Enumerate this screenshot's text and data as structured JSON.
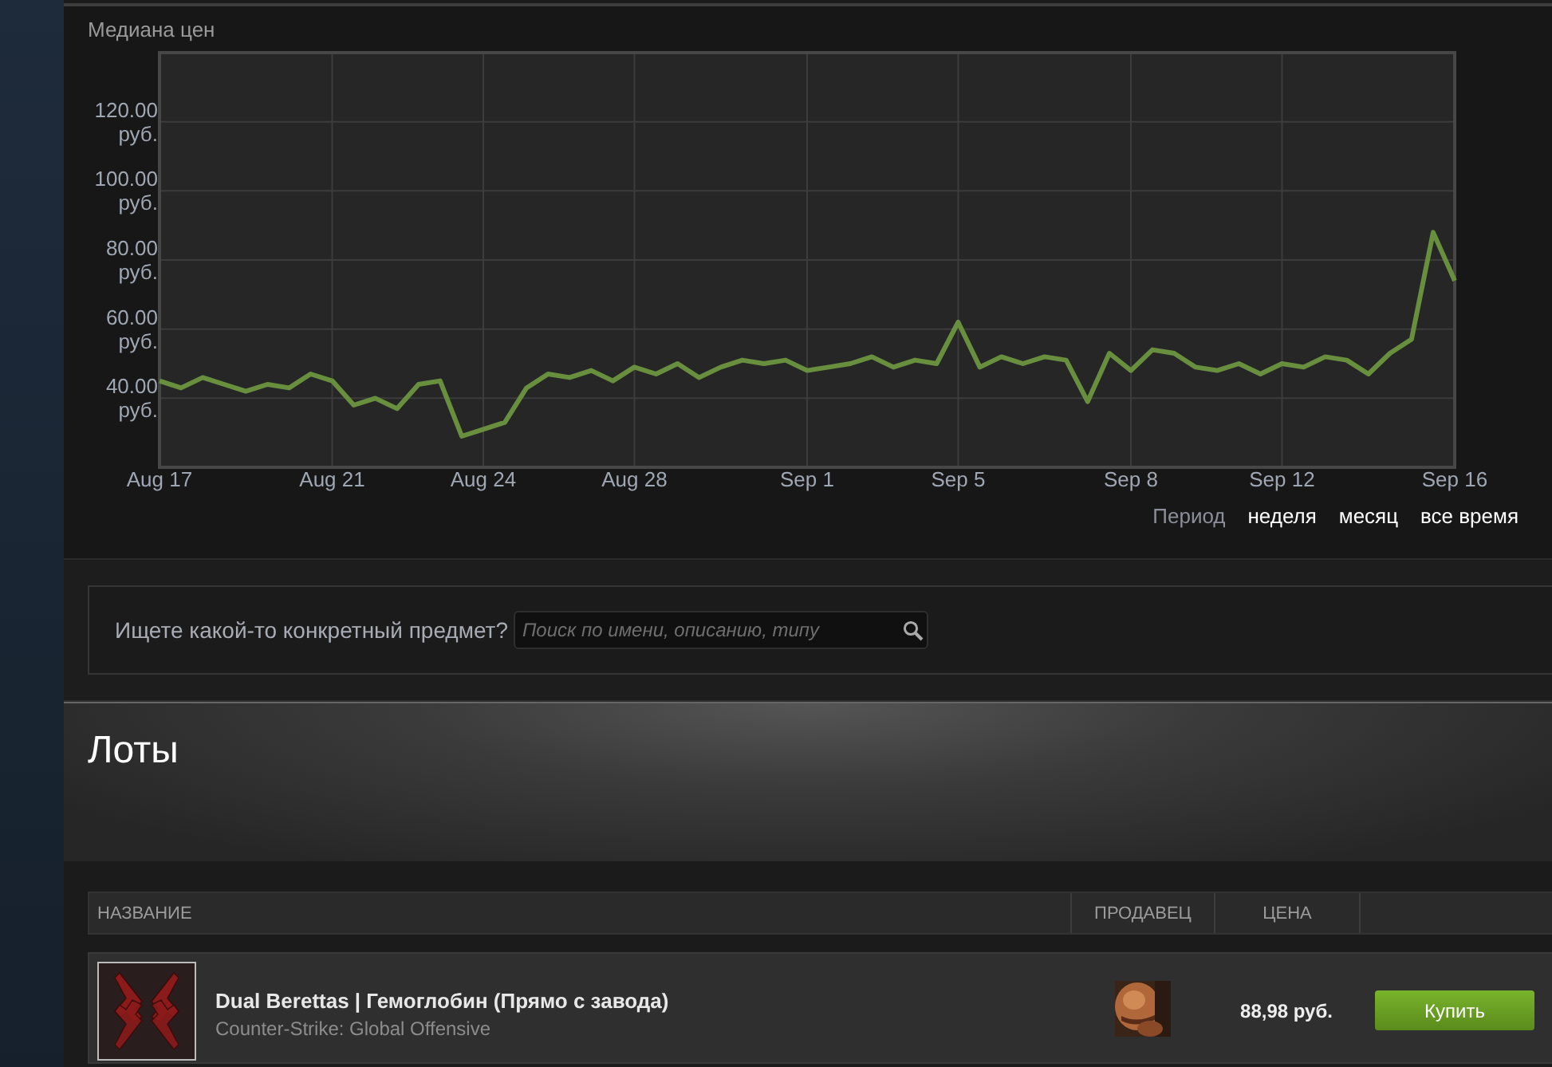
{
  "chart": {
    "chart_data": {
      "type": "line",
      "title": "Медиана цен",
      "categories": [
        "Aug 17",
        null,
        null,
        null,
        null,
        null,
        null,
        null,
        "Aug 21",
        null,
        null,
        null,
        null,
        null,
        null,
        "Aug 24",
        null,
        null,
        null,
        null,
        null,
        null,
        "Aug 28",
        null,
        null,
        null,
        null,
        null,
        null,
        null,
        "Sep 1",
        null,
        null,
        null,
        null,
        null,
        null,
        "Sep 5",
        null,
        null,
        null,
        null,
        null,
        null,
        null,
        "Sep 8",
        null,
        null,
        null,
        null,
        null,
        null,
        "Sep 12",
        null,
        null,
        null,
        null,
        null,
        null,
        null,
        "Sep 16"
      ],
      "grid": true,
      "series": [
        {
          "color": "#688f3e",
          "values": [
            45,
            43,
            46,
            44,
            42,
            44,
            43,
            47,
            45,
            38,
            40,
            37,
            44,
            45,
            29,
            31,
            33,
            43,
            47,
            46,
            48,
            45,
            49,
            47,
            50,
            46,
            49,
            51,
            50,
            51,
            48,
            49,
            50,
            52,
            49,
            51,
            50,
            62,
            49,
            52,
            50,
            52,
            51,
            39,
            53,
            48,
            54,
            53,
            49,
            48,
            50,
            47,
            50,
            49,
            52,
            51,
            47,
            53,
            57,
            88,
            74
          ]
        }
      ],
      "ylim": [
        20,
        140
      ],
      "yticks": [
        {
          "value": 40,
          "label": "40.00 руб."
        },
        {
          "value": 60,
          "label": "60.00 руб."
        },
        {
          "value": 80,
          "label": "80.00 руб."
        },
        {
          "value": 100,
          "label": "100.00 руб."
        },
        {
          "value": 120,
          "label": "120.00 руб."
        }
      ]
    }
  },
  "period": {
    "label": "Период",
    "options": [
      "неделя",
      "месяц",
      "все время"
    ]
  },
  "search": {
    "prompt": "Ищете какой-то конкретный предмет?",
    "placeholder": "Поиск по имени, описанию, типу"
  },
  "listings": {
    "title": "Лоты",
    "columns": [
      "НАЗВАНИЕ",
      "ПРОДАВЕЦ",
      "ЦЕНА"
    ],
    "rows": [
      {
        "name": "Dual Berettas | Гемоглобин (Прямо с завода)",
        "game": "Counter-Strike: Global Offensive",
        "price": "88,98 руб.",
        "button": "Купить"
      }
    ]
  }
}
